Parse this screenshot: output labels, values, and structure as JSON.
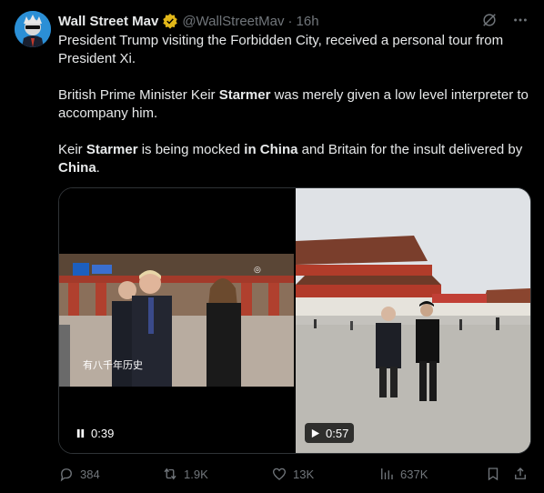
{
  "author": {
    "name": "Wall Street Mav",
    "handle": "@WallStreetMav",
    "separator": "·",
    "time": "16h"
  },
  "post": {
    "p1": "President Trump visiting the Forbidden City, received a personal tour from President Xi.",
    "p2_a": "British Prime Minister Keir ",
    "p2_b": "Starmer",
    "p2_c": " was merely given a low level interpreter to accompany him.",
    "p3_a": "Keir ",
    "p3_b": "Starmer",
    "p3_c": " is being mocked ",
    "p3_d": "in China",
    "p3_e": " and Britain for the insult delivered by ",
    "p3_f": "China",
    "p3_g": "."
  },
  "media": {
    "left_video_time": "0:39",
    "left_caption": "有八千年历史",
    "right_video_time": "0:57"
  },
  "actions": {
    "replies": "384",
    "reposts": "1.9K",
    "likes": "13K",
    "views": "637K"
  },
  "colors": {
    "background": "#000000",
    "text": "#e7e9ea",
    "muted": "#71767b",
    "verified_gold": "#e2b719"
  },
  "icons": [
    "grok-icon",
    "more-icon",
    "verified-badge-icon",
    "reply-icon",
    "repost-icon",
    "like-icon",
    "views-icon",
    "bookmark-icon",
    "share-icon",
    "pause-icon",
    "play-icon"
  ]
}
